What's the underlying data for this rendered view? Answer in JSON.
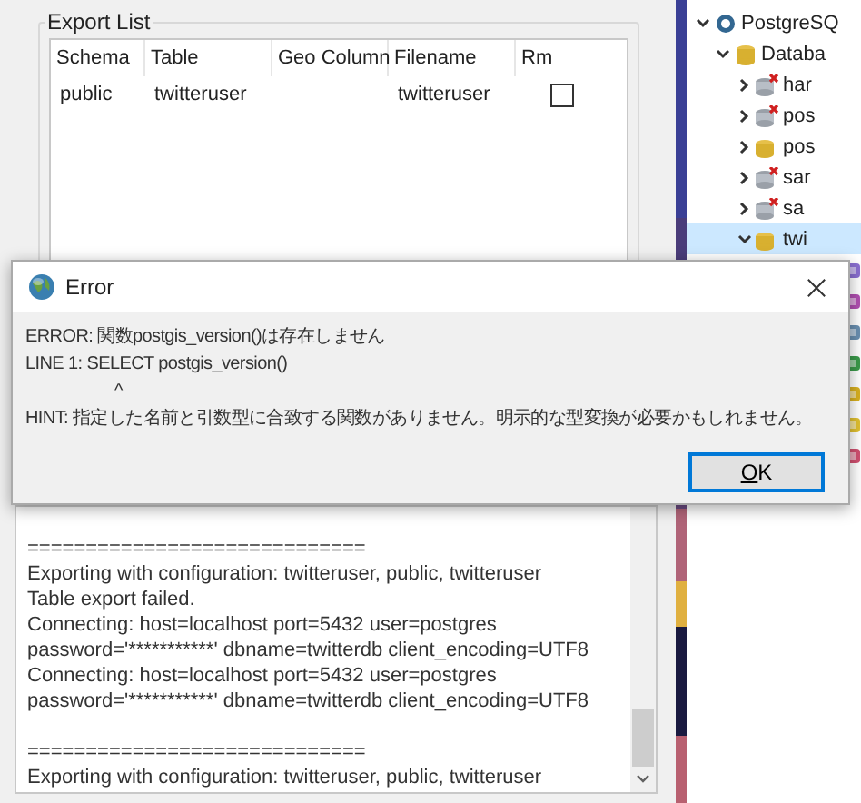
{
  "export_list": {
    "title": "Export List",
    "columns": [
      "Schema",
      "Table",
      "Geo Column",
      "Filename",
      "Rm"
    ],
    "rows": [
      {
        "schema": "public",
        "table": "twitteruser",
        "filename": "twitteruser",
        "rm": false
      }
    ]
  },
  "log": {
    "blocks": [
      [
        "=============================",
        "Exporting with configuration: twitteruser, public, twitteruser",
        "Table export failed.",
        "Connecting:  host=localhost port=5432 user=postgres",
        "password='***********' dbname=twitterdb client_encoding=UTF8",
        "Connecting:  host=localhost port=5432 user=postgres",
        "password='***********' dbname=twitterdb client_encoding=UTF8"
      ],
      [
        "=============================",
        "Exporting with configuration: twitteruser, public, twitteruser"
      ]
    ]
  },
  "tree": {
    "items": [
      {
        "label": "PostgreSQ",
        "expanded": true,
        "children": [
          {
            "label": "Databa",
            "expanded": true,
            "children": [
              {
                "label": "har",
                "connected": false,
                "expanded": false,
                "selected": false
              },
              {
                "label": "pos",
                "connected": false,
                "expanded": false,
                "selected": false
              },
              {
                "label": "pos",
                "connected": true,
                "expanded": false,
                "selected": false
              },
              {
                "label": "sar",
                "connected": false,
                "expanded": false,
                "selected": false
              },
              {
                "label": "sa",
                "connected": false,
                "expanded": false,
                "selected": false
              },
              {
                "label": "twi",
                "connected": true,
                "expanded": true,
                "selected": true,
                "children": [
                  {
                    "kind": "casts"
                  },
                  {
                    "kind": "extensions"
                  },
                  {
                    "kind": "wrappers"
                  },
                  {
                    "kind": "languages"
                  },
                  {
                    "kind": "schemas"
                  },
                  {
                    "kind": "events"
                  },
                  {
                    "kind": "triggers"
                  }
                ]
              }
            ]
          }
        ]
      }
    ]
  },
  "dialog": {
    "title": "Error",
    "lines": [
      {
        "text": "ERROR:  関数postgis_version()は存在しません",
        "kind": "text"
      },
      {
        "text": "LINE 1: SELECT postgis_version()",
        "kind": "text"
      },
      {
        "text": "^",
        "kind": "caret"
      },
      {
        "text": "HINT:  指定した名前と引数型に合致する関数がありません。明示的な型変換が必要かもしれません。",
        "kind": "text"
      }
    ],
    "button": "OK"
  }
}
